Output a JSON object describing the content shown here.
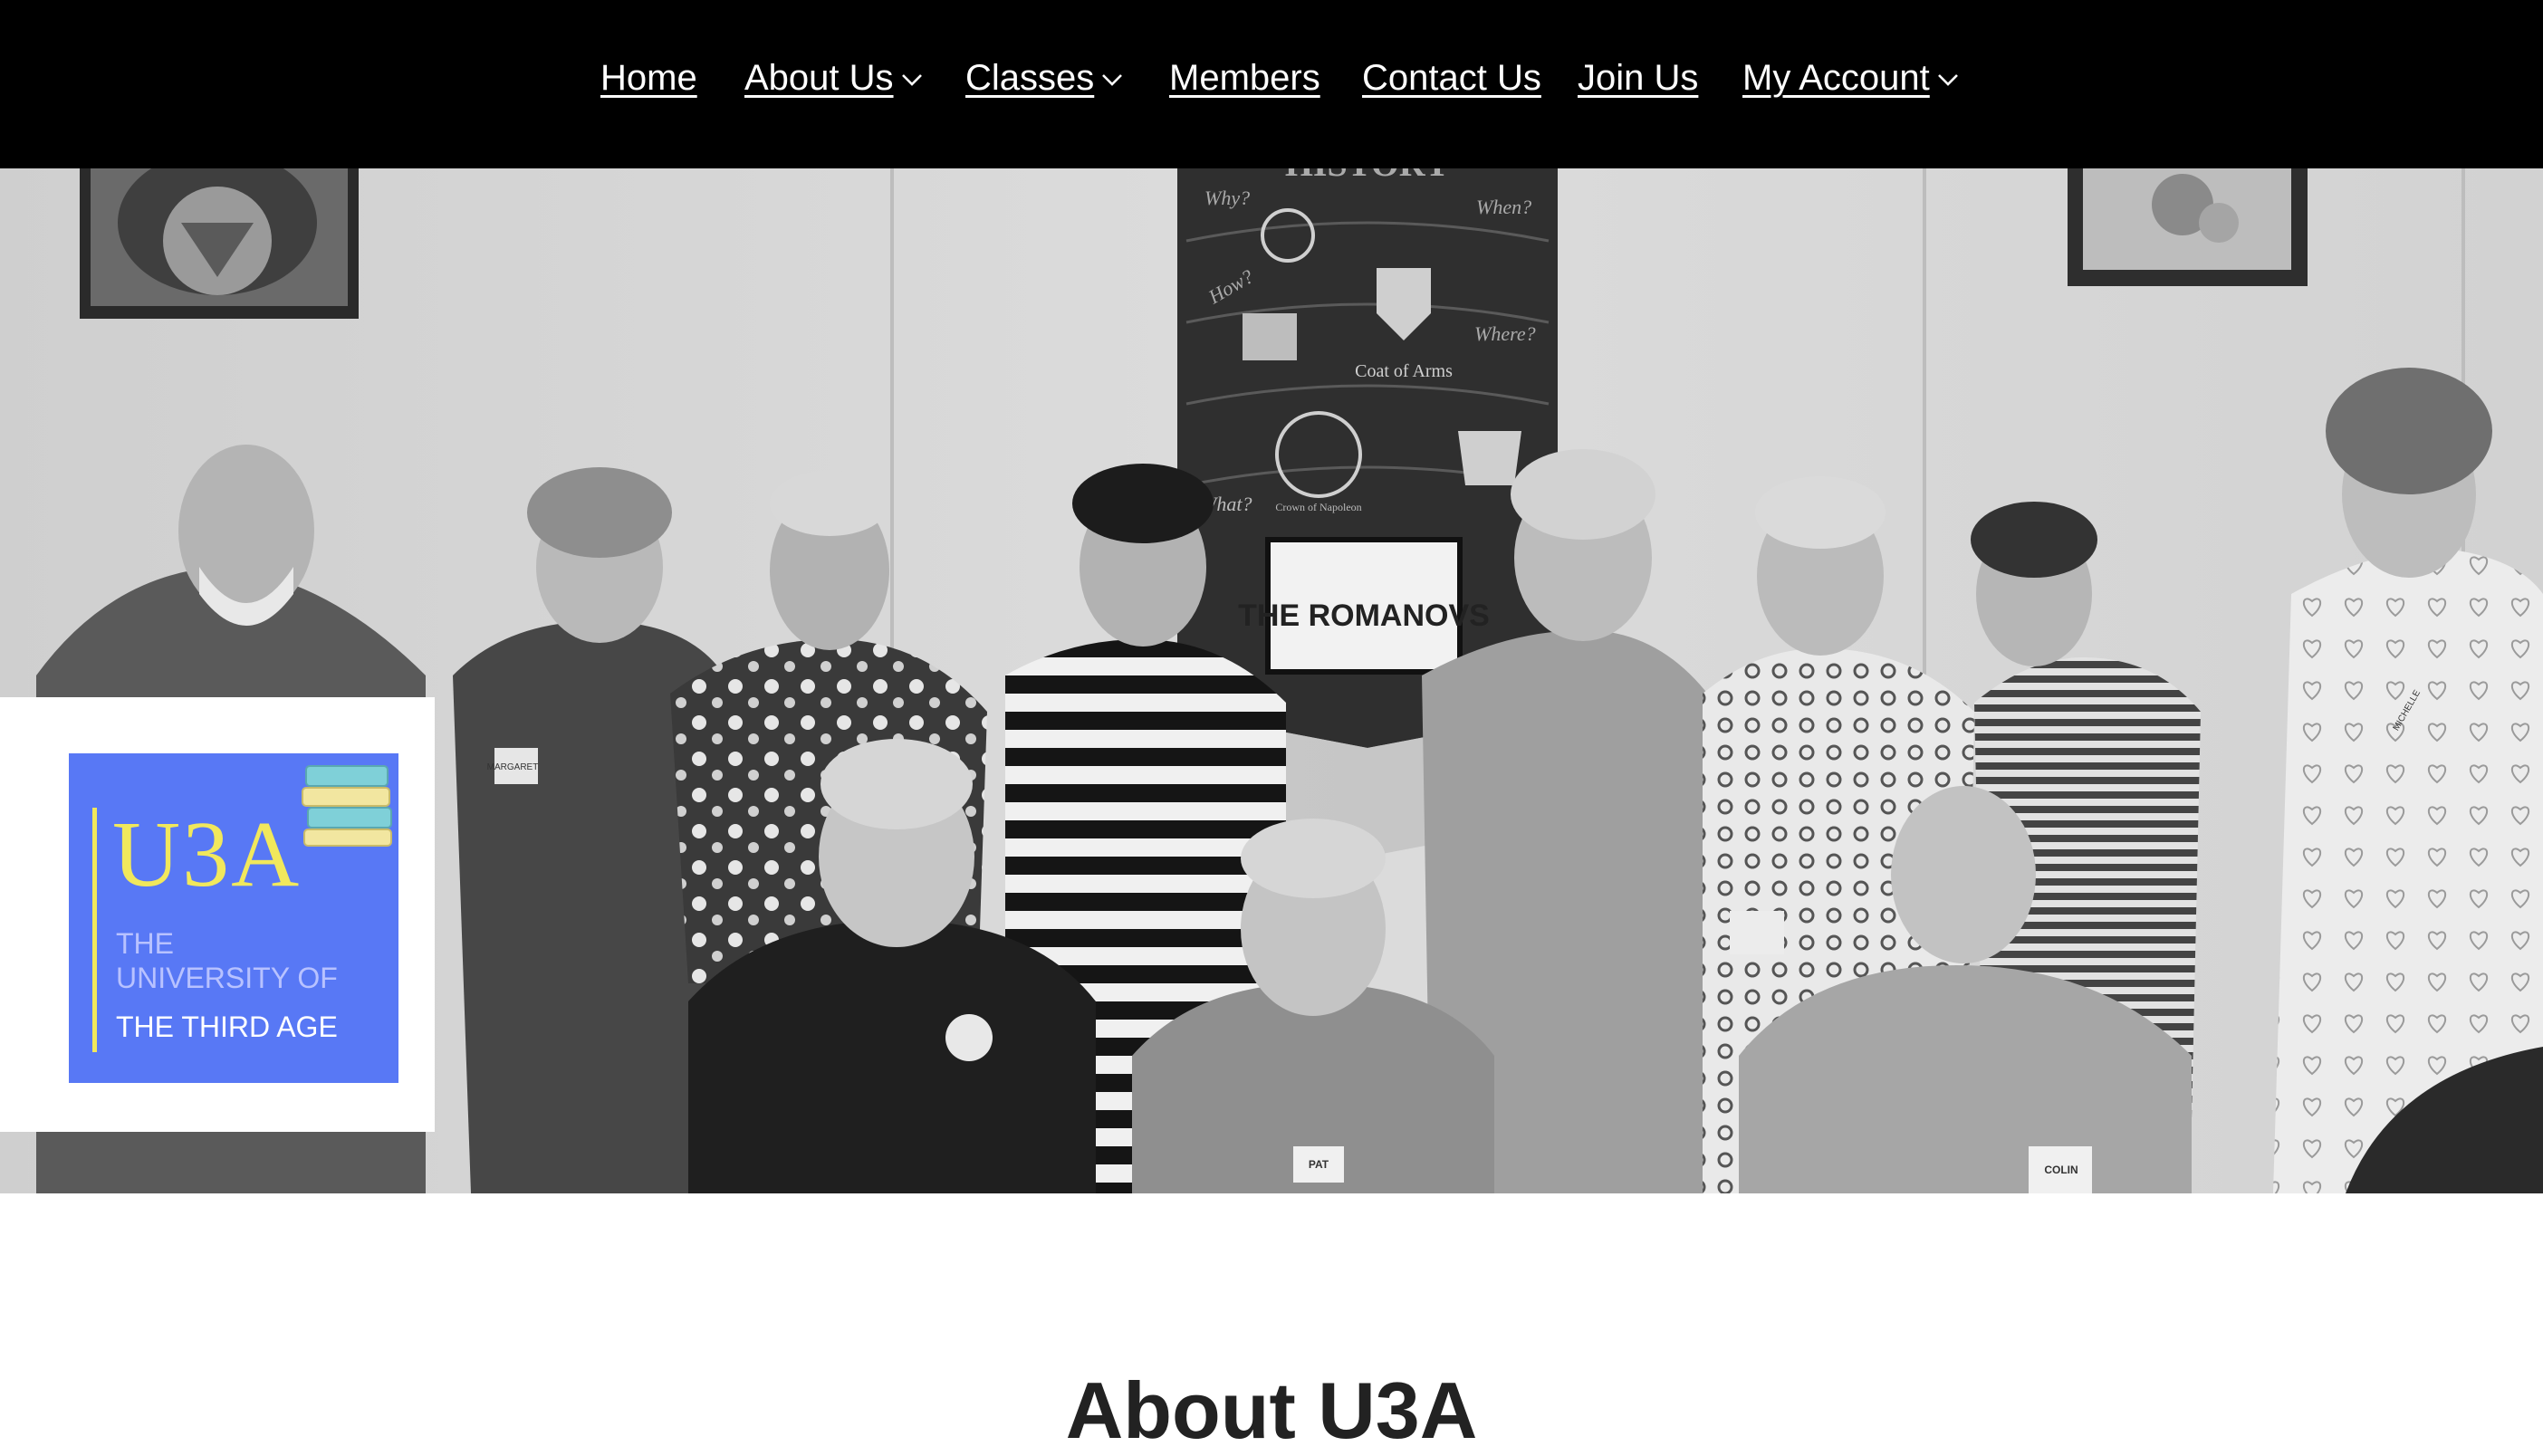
{
  "nav": {
    "items": [
      {
        "label": "Home",
        "has_dropdown": false
      },
      {
        "label": "About Us",
        "has_dropdown": true
      },
      {
        "label": "Classes",
        "has_dropdown": true
      },
      {
        "label": "Members",
        "has_dropdown": false
      },
      {
        "label": "Contact Us",
        "has_dropdown": false
      },
      {
        "label": "Join Us",
        "has_dropdown": false
      },
      {
        "label": "My Account",
        "has_dropdown": true
      }
    ],
    "dropdown_icon": "chevron-down-icon"
  },
  "hero": {
    "banner_title": "HISTORY",
    "banner_words": [
      "Why?",
      "When?",
      "How?",
      "Where?",
      "What?"
    ],
    "banner_captions": [
      "Coat of Arms",
      "Crown of Napoleon"
    ],
    "banner_sign": "THE ROMANOVS",
    "name_tags": [
      "MARGARET",
      "PAT",
      "COLIN",
      "MICHELLE"
    ]
  },
  "logo": {
    "acronym": "U3A",
    "line1": "THE",
    "line2": "UNIVERSITY OF",
    "line3": "THE THIRD AGE",
    "colors": {
      "background": "#5878f5",
      "accent": "#f1e85c"
    }
  },
  "main": {
    "section_title": "About U3A"
  },
  "colors": {
    "nav_background": "#000000",
    "nav_text": "#ffffff"
  }
}
